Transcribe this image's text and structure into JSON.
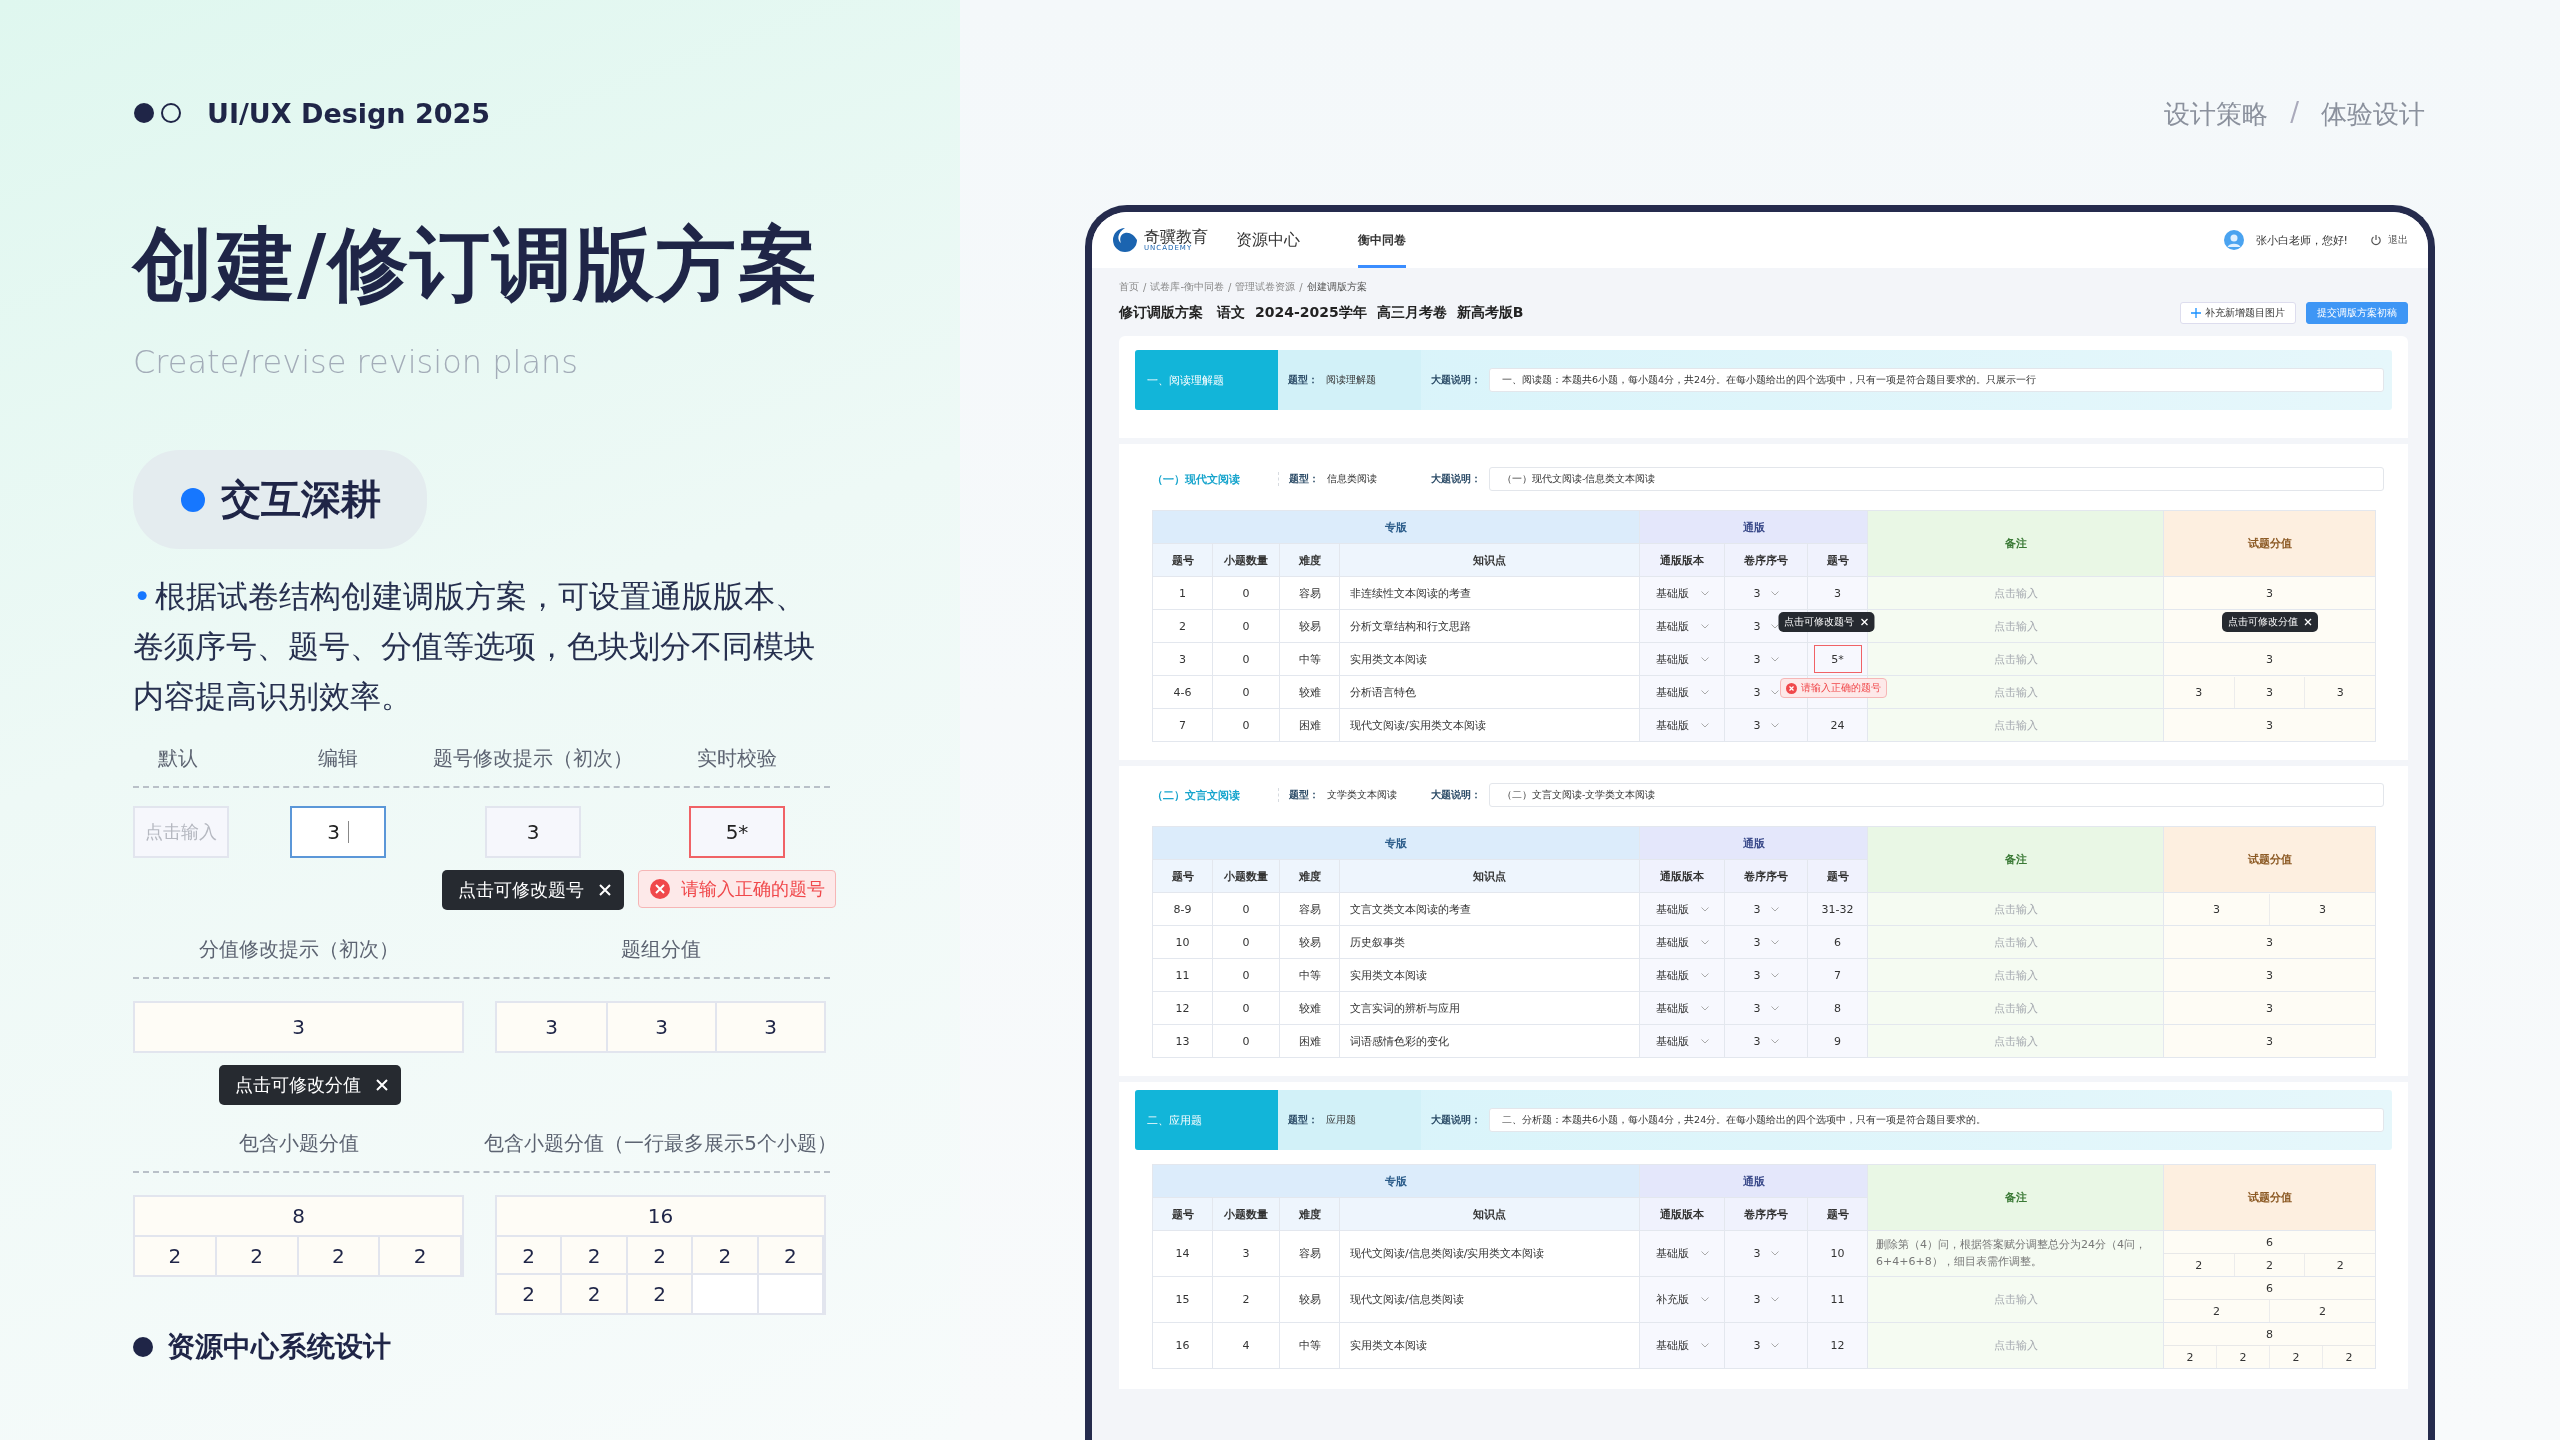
{
  "brand": {
    "title": "UI/UX Design 2025"
  },
  "top_links": {
    "items": [
      "设计策略",
      "体验设计"
    ],
    "separator": "/"
  },
  "headline": "创建/修订调版方案",
  "subtitle": "Create/revise revision plans",
  "pill": "交互深耕",
  "bullet": "•",
  "description": "根据试卷结构创建调版方案，可设置通版版本、卷须序号、题号、分值等选项，色块划分不同模块内容提高识别效率。",
  "demo_inputs": [
    {
      "label": "默认",
      "kind": "default",
      "placeholder": "点击输入"
    },
    {
      "label": "编辑",
      "kind": "editing",
      "value": "3"
    },
    {
      "label": "题号修改提示（初次）",
      "kind": "hint",
      "value": "3",
      "tooltip": "点击可修改题号"
    },
    {
      "label": "实时校验",
      "kind": "error",
      "value": "5*",
      "error": "请输入正确的题号"
    }
  ],
  "demo_scores": [
    {
      "label": "分值修改提示（初次）",
      "total": "3",
      "tooltip": "点击可修改分值"
    },
    {
      "label": "题组分值",
      "cells": [
        "3",
        "3",
        "3"
      ]
    }
  ],
  "demo_subscores": [
    {
      "label": "包含小题分值",
      "total": "8",
      "cells": [
        "2",
        "2",
        "2",
        "2"
      ]
    },
    {
      "label": "包含小题分值（一行最多展示5个小题）",
      "total": "16",
      "cells": [
        "2",
        "2",
        "2",
        "2",
        "2",
        "2",
        "2",
        "2"
      ]
    }
  ],
  "footer_section": "资源中心系统设计",
  "app": {
    "logo": {
      "name": "奇骥教育",
      "sub": "UNCADEMY"
    },
    "center": "资源中心",
    "tabs": [
      {
        "label": "衡中同卷",
        "selected": true
      }
    ],
    "user": "张小白老师，您好!",
    "logout": "退出",
    "breadcrumb": {
      "items": [
        "首页",
        "试卷库-衡中同卷",
        "管理试卷资源",
        "创建调版方案"
      ],
      "separator": "/"
    },
    "title_parts": [
      "修订调版方案",
      "语文",
      "2024-2025学年",
      "高三月考卷",
      "新高考版B"
    ],
    "buttons": [
      {
        "label": "补充新增题目图片",
        "kind": "secondary"
      },
      {
        "label": "提交调版方案初稿",
        "kind": "primary"
      }
    ],
    "sections": [
      {
        "kind": "major",
        "title": "一、阅读理解题",
        "type_label": "题型：",
        "type_value": "阅读理解题",
        "desc_label": "大题说明：",
        "desc": "一、阅读题：本题共6小题，每小题4分，共24分。在每小题给出的四个选项中，只有一项是符合题目要求的。只展示一行"
      },
      {
        "kind": "minor",
        "title": "（一）现代文阅读",
        "type_label": "题型：",
        "type_value": "信息类阅读",
        "desc_label": "大题说明：",
        "desc": "（一）现代文阅读-信息类文本阅读",
        "table": {
          "groups": [
            "专版",
            "通版",
            "备注",
            "试题分值"
          ],
          "columns": [
            "题号",
            "小题数量",
            "难度",
            "知识点",
            "通版版本",
            "卷序序号",
            "题号"
          ],
          "rows": [
            {
              "no": "1",
              "count": "0",
              "difficulty": "容易",
              "knowledge": "非连续性文本阅读的考查",
              "version": "基础版",
              "seq": "3",
              "qno": "3",
              "qno_tooltip": "点击可修改题号",
              "note_placeholder": "点击输入",
              "score": {
                "total": "3"
              },
              "score_tooltip": "点击可修改分值"
            },
            {
              "no": "2",
              "count": "0",
              "difficulty": "较易",
              "knowledge": "分析文章结构和行文思路",
              "version": "基础版",
              "seq": "3",
              "qno": "",
              "note_placeholder": "点击输入",
              "score": {}
            },
            {
              "no": "3",
              "count": "0",
              "difficulty": "中等",
              "knowledge": "实用类文本阅读",
              "version": "基础版",
              "seq": "3",
              "qno": "5*",
              "qno_error": "请输入正确的题号",
              "note_placeholder": "点击输入",
              "score": {
                "total": "3"
              }
            },
            {
              "no": "4-6",
              "count": "0",
              "difficulty": "较难",
              "knowledge": "分析语言特色",
              "version": "基础版",
              "seq": "3",
              "qno": "",
              "note_placeholder": "点击输入",
              "score": {
                "cells": [
                  "3",
                  "3",
                  "3"
                ]
              }
            },
            {
              "no": "7",
              "count": "0",
              "difficulty": "困难",
              "knowledge": "现代文阅读/实用类文本阅读",
              "version": "基础版",
              "seq": "3",
              "qno": "24",
              "note_placeholder": "点击输入",
              "score": {
                "total": "3"
              }
            }
          ]
        }
      },
      {
        "kind": "minor",
        "title": "（二）文言文阅读",
        "type_label": "题型：",
        "type_value": "文学类文本阅读",
        "desc_label": "大题说明：",
        "desc": "（二）文言文阅读-文学类文本阅读",
        "table": {
          "groups": [
            "专版",
            "通版",
            "备注",
            "试题分值"
          ],
          "columns": [
            "题号",
            "小题数量",
            "难度",
            "知识点",
            "通版版本",
            "卷序序号",
            "题号"
          ],
          "rows": [
            {
              "no": "8-9",
              "count": "0",
              "difficulty": "容易",
              "knowledge": "文言文类文本阅读的考查",
              "version": "基础版",
              "seq": "3",
              "qno": "31-32",
              "note_placeholder": "点击输入",
              "score": {
                "cells": [
                  "3",
                  "3"
                ]
              }
            },
            {
              "no": "10",
              "count": "0",
              "difficulty": "较易",
              "knowledge": "历史叙事类",
              "version": "基础版",
              "seq": "3",
              "qno": "6",
              "note_placeholder": "点击输入",
              "score": {
                "total": "3"
              }
            },
            {
              "no": "11",
              "count": "0",
              "difficulty": "中等",
              "knowledge": "实用类文本阅读",
              "version": "基础版",
              "seq": "3",
              "qno": "7",
              "note_placeholder": "点击输入",
              "score": {
                "total": "3"
              }
            },
            {
              "no": "12",
              "count": "0",
              "difficulty": "较难",
              "knowledge": "文言实词的辨析与应用",
              "version": "基础版",
              "seq": "3",
              "qno": "8",
              "note_placeholder": "点击输入",
              "score": {
                "total": "3"
              }
            },
            {
              "no": "13",
              "count": "0",
              "difficulty": "困难",
              "knowledge": "词语感情色彩的变化",
              "version": "基础版",
              "seq": "3",
              "qno": "9",
              "note_placeholder": "点击输入",
              "score": {
                "total": "3"
              }
            }
          ]
        }
      },
      {
        "kind": "major",
        "title": "二、应用题",
        "type_label": "题型：",
        "type_value": "应用题",
        "desc_label": "大题说明：",
        "desc": "二、分析题：本题共6小题，每小题4分，共24分。在每小题给出的四个选项中，只有一项是符合题目要求的。",
        "table": {
          "groups": [
            "专版",
            "通版",
            "备注",
            "试题分值"
          ],
          "columns": [
            "题号",
            "小题数量",
            "难度",
            "知识点",
            "通版版本",
            "卷序序号",
            "题号"
          ],
          "rows": [
            {
              "no": "14",
              "count": "3",
              "difficulty": "容易",
              "knowledge": "现代文阅读/信息类阅读/实用类文本阅读",
              "version": "基础版",
              "seq": "3",
              "qno": "10",
              "note": "删除第（4）问，根据答案赋分调整总分为24分（4问，6+4+6+8），细目表需作调整。",
              "score": {
                "total": "6",
                "cells": [
                  "2",
                  "2",
                  "2"
                ]
              }
            },
            {
              "no": "15",
              "count": "2",
              "difficulty": "较易",
              "knowledge": "现代文阅读/信息类阅读",
              "version": "补充版",
              "seq": "3",
              "qno": "11",
              "note_placeholder": "点击输入",
              "score": {
                "total": "6",
                "cells": [
                  "2",
                  "2"
                ]
              }
            },
            {
              "no": "16",
              "count": "4",
              "difficulty": "中等",
              "knowledge": "实用类文本阅读",
              "version": "基础版",
              "seq": "3",
              "qno": "12",
              "note_placeholder": "点击输入",
              "score": {
                "total": "8",
                "cells": [
                  "2",
                  "2",
                  "2",
                  "2"
                ]
              }
            }
          ]
        }
      }
    ]
  }
}
